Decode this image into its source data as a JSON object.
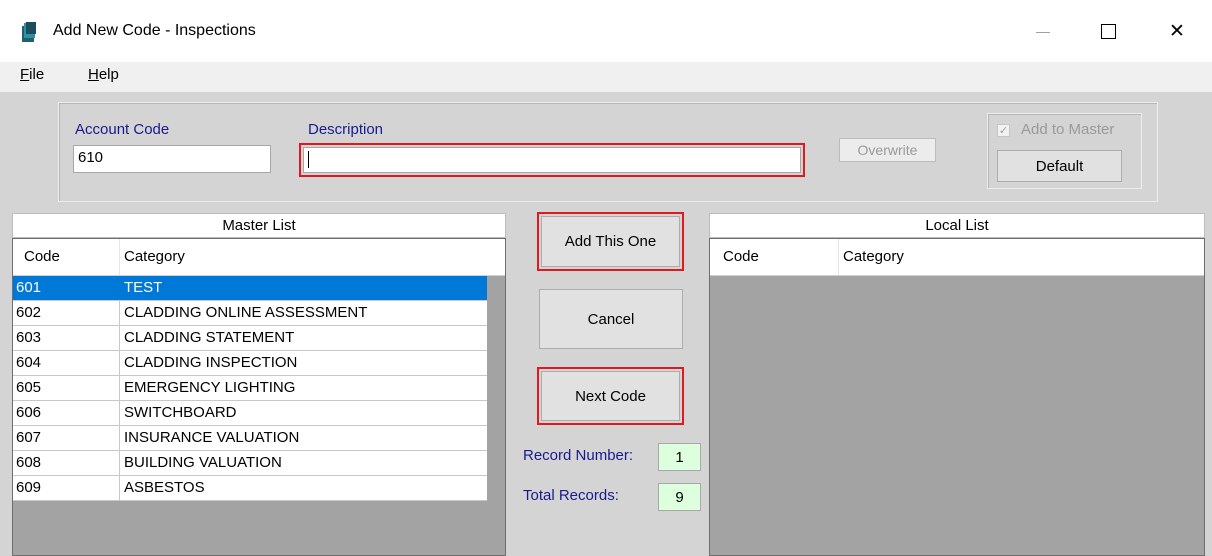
{
  "window": {
    "title": "Add New Code - Inspections",
    "minimize_glyph": "—",
    "maximize_glyph": "☐",
    "close_glyph": "✕"
  },
  "menu": {
    "file": {
      "accel": "F",
      "rest": "ile"
    },
    "help": {
      "accel": "H",
      "rest": "elp"
    }
  },
  "form": {
    "account_code_label": "Account Code",
    "account_code_value": "610",
    "description_label": "Description",
    "description_value": "",
    "overwrite_label": "Overwrite",
    "add_to_master_label": "Add to Master",
    "add_to_master_checked": true,
    "default_label": "Default"
  },
  "master_list": {
    "title": "Master List",
    "columns": [
      "Code",
      "Category"
    ],
    "selected_index": 0,
    "rows": [
      {
        "code": "601",
        "category": "TEST"
      },
      {
        "code": "602",
        "category": "CLADDING ONLINE ASSESSMENT"
      },
      {
        "code": "603",
        "category": "CLADDING STATEMENT"
      },
      {
        "code": "604",
        "category": "CLADDING INSPECTION"
      },
      {
        "code": "605",
        "category": "EMERGENCY LIGHTING"
      },
      {
        "code": "606",
        "category": "SWITCHBOARD"
      },
      {
        "code": "607",
        "category": "INSURANCE VALUATION"
      },
      {
        "code": "608",
        "category": "BUILDING VALUATION"
      },
      {
        "code": "609",
        "category": "ASBESTOS"
      }
    ]
  },
  "actions": {
    "add_this_one": "Add This One",
    "cancel": "Cancel",
    "next_code": "Next Code",
    "record_number_label": "Record Number:",
    "record_number_value": "1",
    "total_records_label": "Total Records:",
    "total_records_value": "9"
  },
  "local_list": {
    "title": "Local List",
    "columns": [
      "Code",
      "Category"
    ]
  },
  "colors": {
    "highlight_red": "#e0191f",
    "selection_blue": "#0078d7",
    "label_blue": "#1a1a8f",
    "counter_green": "#ddffdd"
  }
}
